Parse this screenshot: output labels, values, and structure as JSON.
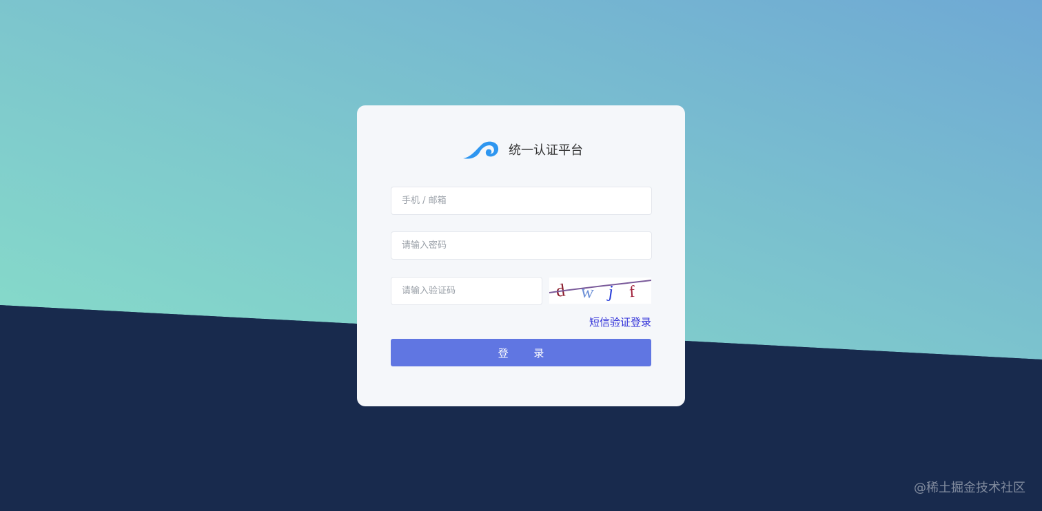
{
  "brand": {
    "title": "统一认证平台",
    "logo_icon": "wave-logo-icon",
    "logo_color": "#2e96f0"
  },
  "form": {
    "account_placeholder": "手机 / 邮箱",
    "account_value": "",
    "password_placeholder": "请输入密码",
    "password_value": "",
    "captcha_placeholder": "请输入验证码",
    "captcha_value": "",
    "captcha_image_text": "dwjf"
  },
  "links": {
    "sms_login": "短信验证登录"
  },
  "actions": {
    "login_label": "登 录"
  },
  "footer": {
    "watermark": "@稀土掘金技术社区"
  },
  "colors": {
    "accent_button": "#6076e2",
    "link": "#2f2fd8",
    "bg_dark": "#182a4d"
  }
}
